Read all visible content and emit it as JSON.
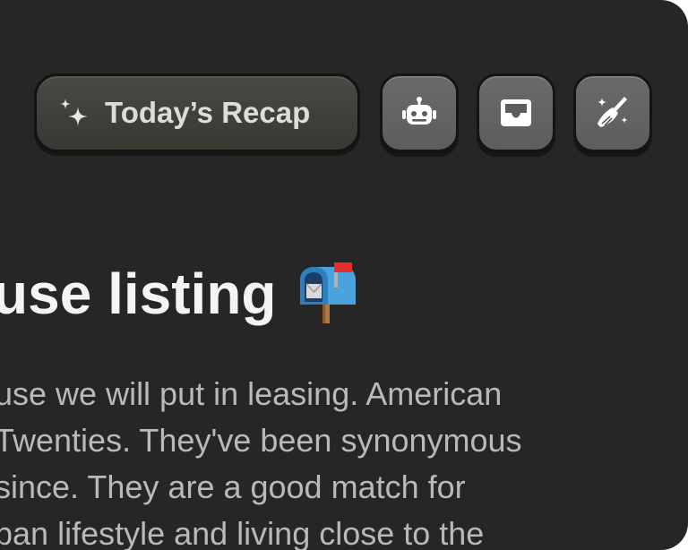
{
  "toolbar": {
    "recap_label": "Today’s Recap",
    "recap_icon": "sparkles-icon",
    "buttons": [
      {
        "name": "robot-icon"
      },
      {
        "name": "inbox-icon"
      },
      {
        "name": "broom-sparkle-icon"
      }
    ]
  },
  "document": {
    "title": "use listing",
    "title_emoji": "mailbox-icon",
    "lines": [
      "use we will put in leasing. American",
      "Twenties. They've been synonymous",
      " since. They are a good match for",
      "pan lifestyle and living close to the"
    ]
  },
  "colors": {
    "window_bg": "#262626",
    "button_bg": "#5d5d5d",
    "recap_bg": "#3f3f39",
    "title_text": "#f4f4f4",
    "body_text": "#b9b9b9"
  }
}
